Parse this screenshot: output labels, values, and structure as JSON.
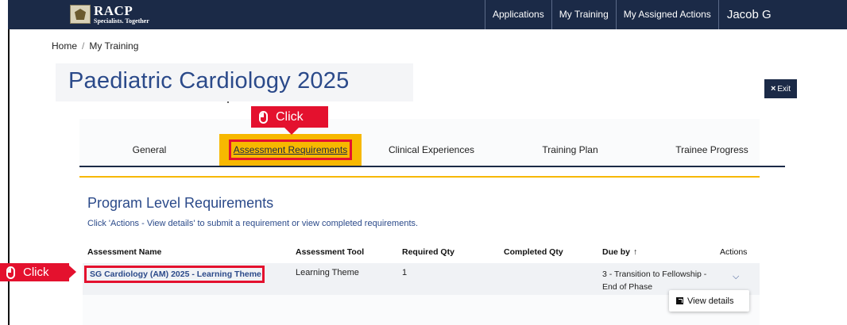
{
  "nav": {
    "logo_title": "RACP",
    "logo_subtitle": "Specialists. Together",
    "links": [
      "Applications",
      "My Training",
      "My Assigned Actions"
    ],
    "user": "Jacob G"
  },
  "breadcrumb": {
    "home": "Home",
    "sep": "/",
    "current": "My Training"
  },
  "page_title": "Paediatric Cardiology 2025",
  "exit_label": "Exit",
  "callouts": {
    "top": "Click",
    "left": "Click"
  },
  "tabs": [
    "General",
    "Assessment Requirements",
    "Clinical Experiences",
    "Training Plan",
    "Trainee Progress"
  ],
  "active_tab": "Assessment Requirements",
  "section": {
    "title": "Program Level Requirements",
    "help": "Click 'Actions - View details' to submit a requirement or view completed requirements."
  },
  "table": {
    "headers": {
      "name": "Assessment Name",
      "tool": "Assessment Tool",
      "required": "Required Qty",
      "completed": "Completed Qty",
      "due": "Due by",
      "actions": "Actions"
    },
    "rows": [
      {
        "name": "SG Cardiology (AM) 2025 - Learning Theme -",
        "tool": "Learning Theme",
        "required": "1",
        "completed": "",
        "due_line1": "3 - Transition to Fellowship -",
        "due_line2": "End of Phase"
      }
    ]
  },
  "dropdown": {
    "view_details": "View details"
  }
}
